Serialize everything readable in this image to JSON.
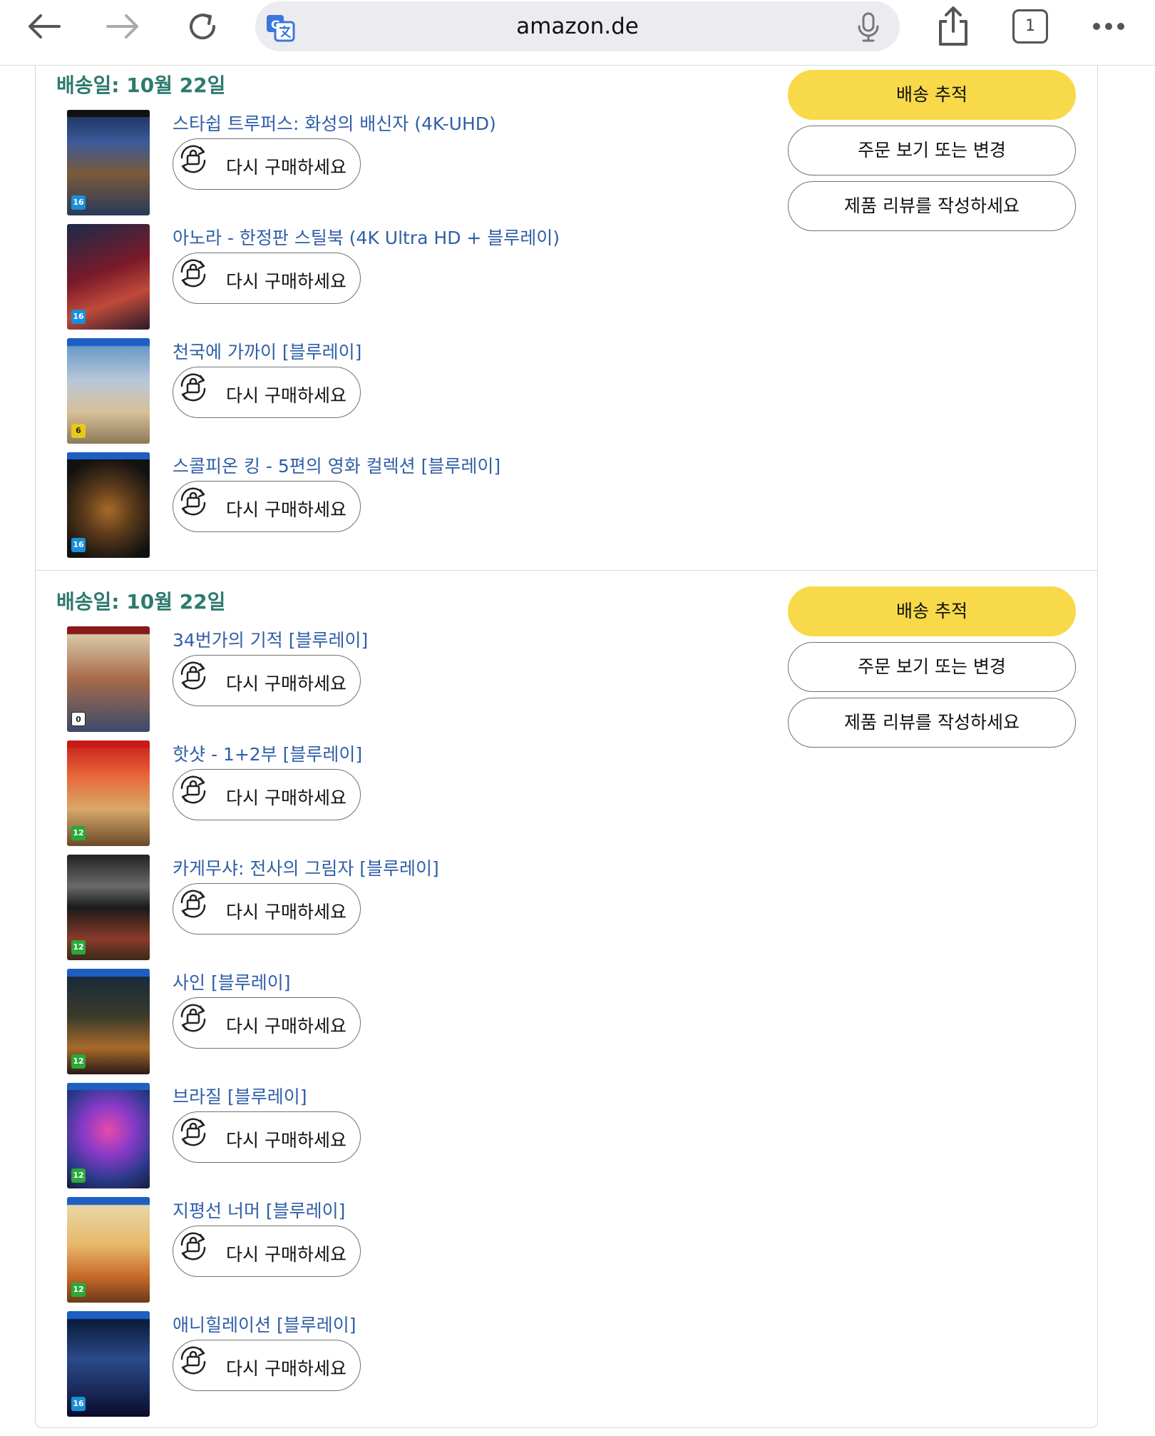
{
  "browser": {
    "url": "amazon.de",
    "tab_count": "1"
  },
  "orders": [
    {
      "ship_date": "배송일: 10월 22일",
      "actions": {
        "track": "배송 추적",
        "view_or_edit": "주문 보기 또는 변경",
        "write_review": "제품 리뷰를 작성하세요"
      },
      "items": [
        {
          "title": "스타쉽 트루퍼스: 화성의 배신자 (4K-UHD)",
          "rebuy_label": "다시 구매하세요"
        },
        {
          "title": "아노라 - 한정판 스틸북 (4K Ultra HD + 블루레이)",
          "rebuy_label": "다시 구매하세요"
        },
        {
          "title": "천국에 가까이 [블루레이]",
          "rebuy_label": "다시 구매하세요"
        },
        {
          "title": "스콜피온 킹 - 5편의 영화 컬렉션 [블루레이]",
          "rebuy_label": "다시 구매하세요"
        }
      ]
    },
    {
      "ship_date": "배송일: 10월 22일",
      "actions": {
        "track": "배송 추적",
        "view_or_edit": "주문 보기 또는 변경",
        "write_review": "제품 리뷰를 작성하세요"
      },
      "items": [
        {
          "title": "34번가의 기적 [블루레이]",
          "rebuy_label": "다시 구매하세요"
        },
        {
          "title": "핫샷 - 1+2부 [블루레이]",
          "rebuy_label": "다시 구매하세요"
        },
        {
          "title": "카게무샤: 전사의 그림자 [블루레이]",
          "rebuy_label": "다시 구매하세요"
        },
        {
          "title": "사인 [블루레이]",
          "rebuy_label": "다시 구매하세요"
        },
        {
          "title": "브라질 [블루레이]",
          "rebuy_label": "다시 구매하세요"
        },
        {
          "title": "지평선 너머 [블루레이]",
          "rebuy_label": "다시 구매하세요"
        },
        {
          "title": "애니힐레이션 [블루레이]",
          "rebuy_label": "다시 구매하세요"
        }
      ]
    }
  ],
  "colors": {
    "ship_date": "#2d7a6e",
    "item_link": "#2f5ea8",
    "primary_button": "#f8d94a"
  }
}
